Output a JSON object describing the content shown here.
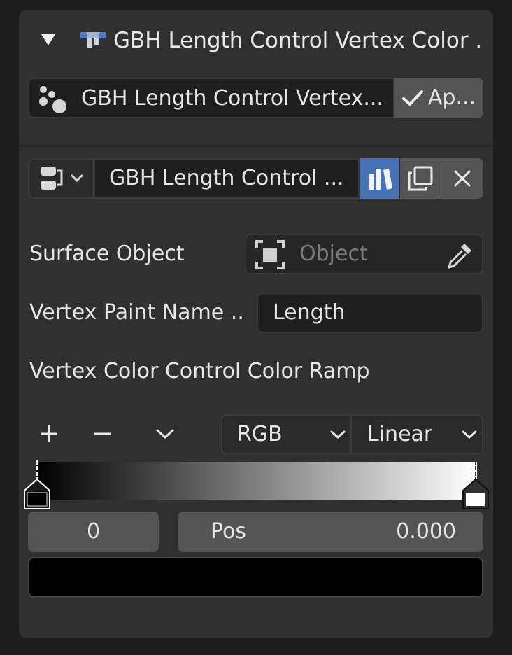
{
  "header": {
    "title": "GBH Length Control Vertex Color ..."
  },
  "modifier_selector": {
    "name": "GBH Length Control Vertex...",
    "apply_label": "Ap..."
  },
  "node_group": {
    "name": "GBH Length Control ..."
  },
  "inputs": {
    "surface_object_label": "Surface Object",
    "surface_object_placeholder": "Object",
    "vertex_paint_label": "Vertex Paint Name ...",
    "vertex_paint_value": "Length",
    "color_ramp_label": "Vertex Color Control Color Ramp"
  },
  "color_ramp": {
    "color_mode": "RGB",
    "interpolation": "Linear",
    "active_index": "0",
    "pos_label": "Pos",
    "pos_value": "0.000",
    "stops": [
      {
        "position": 0.0,
        "color": "#000000"
      },
      {
        "position": 1.0,
        "color": "#ffffff"
      }
    ],
    "active_color": "#000000"
  },
  "colors": {
    "accent_blue": "#4772b3",
    "panel_bg": "#303030",
    "field_bg": "#1f1f1f",
    "button_bg": "#545454"
  }
}
